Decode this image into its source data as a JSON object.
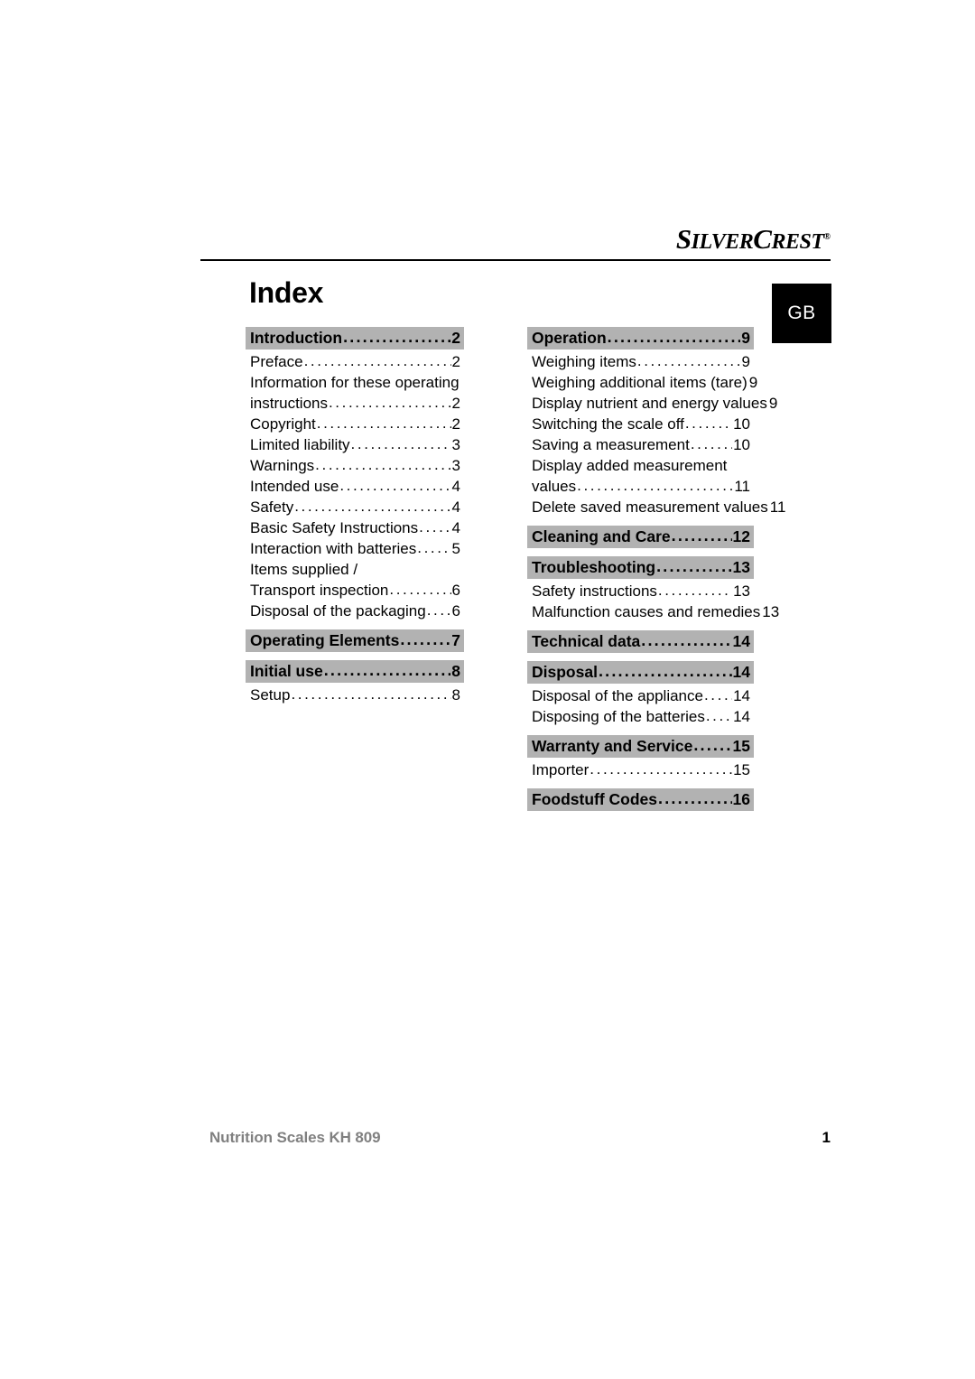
{
  "brand": {
    "s": "S",
    "ilver": "ILVER",
    "c": "C",
    "rest": "REST",
    "registered": "®"
  },
  "badge": {
    "label": "GB"
  },
  "title": "Index",
  "toc": {
    "left": [
      {
        "type": "section",
        "label": "Introduction",
        "page": "2"
      },
      {
        "type": "item",
        "label": "Preface",
        "page": "2"
      },
      {
        "type": "cont",
        "label": "Information for these operating",
        "page": ""
      },
      {
        "type": "item",
        "label": "instructions",
        "page": "2"
      },
      {
        "type": "item",
        "label": "Copyright",
        "page": "2"
      },
      {
        "type": "item",
        "label": "Limited liability",
        "page": "3"
      },
      {
        "type": "item",
        "label": "Warnings",
        "page": "3"
      },
      {
        "type": "item",
        "label": "Intended use",
        "page": "4"
      },
      {
        "type": "item",
        "label": "Safety",
        "page": "4"
      },
      {
        "type": "item",
        "label": "Basic Safety Instructions",
        "page": "4"
      },
      {
        "type": "item",
        "label": "Interaction with batteries",
        "page": "5"
      },
      {
        "type": "cont",
        "label": "Items supplied /",
        "page": ""
      },
      {
        "type": "item",
        "label": "Transport inspection",
        "page": "6"
      },
      {
        "type": "item",
        "label": "Disposal of the packaging",
        "page": "6"
      },
      {
        "type": "section",
        "label": "Operating Elements",
        "page": "7"
      },
      {
        "type": "section",
        "label": "Initial use",
        "page": "8"
      },
      {
        "type": "item",
        "label": "Setup",
        "page": "8"
      }
    ],
    "right": [
      {
        "type": "section",
        "label": "Operation",
        "page": "9"
      },
      {
        "type": "item",
        "label": "Weighing items",
        "page": "9"
      },
      {
        "type": "item",
        "label": "Weighing additional items (tare)",
        "page": "9"
      },
      {
        "type": "item",
        "label": "Display nutrient and energy values",
        "page": "9"
      },
      {
        "type": "item",
        "label": "Switching the scale off",
        "page": "10"
      },
      {
        "type": "item",
        "label": "Saving a measurement",
        "page": "10"
      },
      {
        "type": "cont",
        "label": "Display added measurement",
        "page": ""
      },
      {
        "type": "item",
        "label": "values",
        "page": "11"
      },
      {
        "type": "item",
        "label": "Delete saved measurement values",
        "page": "11"
      },
      {
        "type": "section",
        "label": "Cleaning and Care",
        "page": "12"
      },
      {
        "type": "section",
        "label": "Troubleshooting",
        "page": "13"
      },
      {
        "type": "item",
        "label": "Safety instructions",
        "page": "13"
      },
      {
        "type": "item",
        "label": "Malfunction causes and remedies",
        "page": "13"
      },
      {
        "type": "section",
        "label": "Technical data",
        "page": "14"
      },
      {
        "type": "section",
        "label": "Disposal",
        "page": "14"
      },
      {
        "type": "item",
        "label": "Disposal of the appliance",
        "page": "14"
      },
      {
        "type": "item",
        "label": "Disposing of the batteries",
        "page": "14"
      },
      {
        "type": "section",
        "label": "Warranty and Service",
        "page": "15"
      },
      {
        "type": "item",
        "label": "Importer",
        "page": "15"
      },
      {
        "type": "section",
        "label": "Foodstuff Codes",
        "page": "16"
      }
    ]
  },
  "footer": {
    "title": "Nutrition Scales KH 809",
    "page": "1"
  },
  "colors": {
    "section_band": "#b2b2b2",
    "footer_title": "#808080",
    "badge_background": "#000000",
    "text": "#000000"
  }
}
